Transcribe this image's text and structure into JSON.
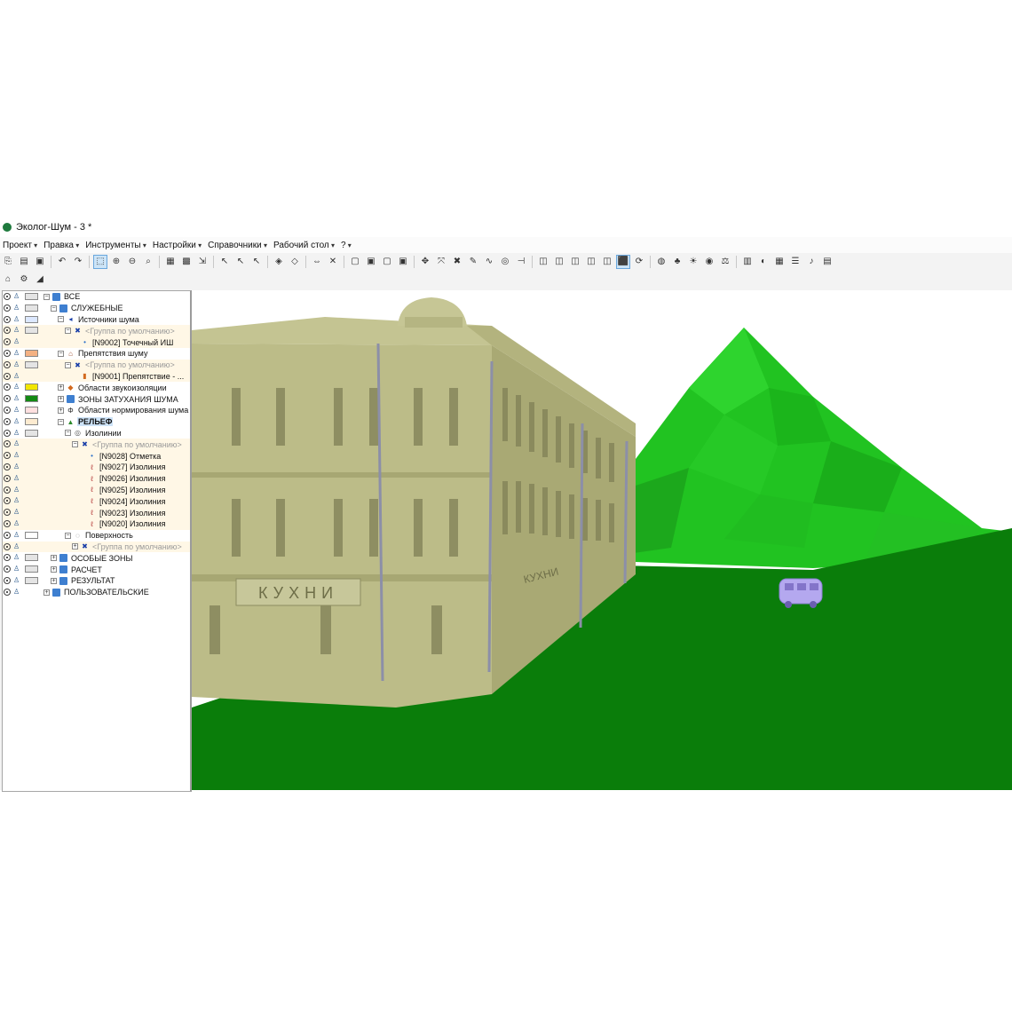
{
  "window": {
    "title": "Эколог-Шум - 3 *"
  },
  "menu": [
    "Проект",
    "Правка",
    "Инструменты",
    "Настройки",
    "Справочники",
    "Рабочий стол",
    "?"
  ],
  "tree": {
    "rows": [
      {
        "label": "ВСЕ",
        "indent": 0,
        "expander": "−",
        "icon": "folder",
        "swatch": "#e4e4e4",
        "tinted": false
      },
      {
        "label": "СЛУЖЕБНЫЕ",
        "indent": 1,
        "expander": "−",
        "icon": "folder",
        "swatch": "#e4e4e4",
        "tinted": false
      },
      {
        "label": "Источники шума",
        "indent": 2,
        "expander": "−",
        "icon": "noise-source",
        "swatch": "#dce8ff",
        "tinted": false
      },
      {
        "label": "<Группа по умолчанию>",
        "indent": 3,
        "expander": "−",
        "icon": "group",
        "swatch": "#e4e4e4",
        "tinted": true,
        "grey": true
      },
      {
        "label": "[N9002] Точечный ИШ",
        "indent": 4,
        "expander": "",
        "icon": "dot",
        "swatch": "",
        "tinted": true
      },
      {
        "label": "Препятствия шуму",
        "indent": 2,
        "expander": "−",
        "icon": "obstacle",
        "swatch": "#f4b183",
        "tinted": false
      },
      {
        "label": "<Группа по умолчанию>",
        "indent": 3,
        "expander": "−",
        "icon": "group",
        "swatch": "#e4e4e4",
        "tinted": true,
        "grey": true
      },
      {
        "label": "[N9001] Препятствие - ...",
        "indent": 4,
        "expander": "",
        "icon": "obstacle-item",
        "swatch": "",
        "tinted": true
      },
      {
        "label": "Области звукоизоляции",
        "indent": 2,
        "expander": "+",
        "icon": "insulation",
        "swatch": "#f2e600",
        "tinted": false
      },
      {
        "label": "ЗОНЫ ЗАТУХАНИЯ ШУМА",
        "indent": 2,
        "expander": "+",
        "icon": "folder",
        "swatch": "#138a13",
        "tinted": false
      },
      {
        "label": "Области нормирования шума",
        "indent": 2,
        "expander": "+",
        "icon": "norm",
        "swatch": "#ffe0e0",
        "tinted": false
      },
      {
        "label": "РЕЛЬЕФ",
        "indent": 2,
        "expander": "−",
        "icon": "relief",
        "swatch": "#fdebd0",
        "tinted": false,
        "selected": true
      },
      {
        "label": "Изолинии",
        "indent": 3,
        "expander": "−",
        "icon": "isoline-group",
        "swatch": "#e4e4e4",
        "tinted": false
      },
      {
        "label": "<Группа по умолчанию>",
        "indent": 4,
        "expander": "−",
        "icon": "group",
        "swatch": "",
        "tinted": true,
        "grey": true
      },
      {
        "label": "[N9028] Отметка",
        "indent": 5,
        "expander": "",
        "icon": "dot",
        "swatch": "",
        "tinted": true
      },
      {
        "label": "[N9027] Изолиния",
        "indent": 5,
        "expander": "",
        "icon": "isoline",
        "swatch": "",
        "tinted": true
      },
      {
        "label": "[N9026] Изолиния",
        "indent": 5,
        "expander": "",
        "icon": "isoline",
        "swatch": "",
        "tinted": true
      },
      {
        "label": "[N9025] Изолиния",
        "indent": 5,
        "expander": "",
        "icon": "isoline",
        "swatch": "",
        "tinted": true
      },
      {
        "label": "[N9024] Изолиния",
        "indent": 5,
        "expander": "",
        "icon": "isoline",
        "swatch": "",
        "tinted": true
      },
      {
        "label": "[N9023] Изолиния",
        "indent": 5,
        "expander": "",
        "icon": "isoline",
        "swatch": "",
        "tinted": true
      },
      {
        "label": "[N9020] Изолиния",
        "indent": 5,
        "expander": "",
        "icon": "isoline",
        "swatch": "",
        "tinted": true
      },
      {
        "label": "Поверхность",
        "indent": 3,
        "expander": "−",
        "icon": "surface",
        "swatch": "#ffffff",
        "tinted": false
      },
      {
        "label": "<Группа по умолчанию>",
        "indent": 4,
        "expander": "+",
        "icon": "group",
        "swatch": "",
        "tinted": true,
        "grey": true
      },
      {
        "label": "ОСОБЫЕ ЗОНЫ",
        "indent": 1,
        "expander": "+",
        "icon": "folder",
        "swatch": "#e4e4e4",
        "tinted": false
      },
      {
        "label": "РАСЧЕТ",
        "indent": 1,
        "expander": "+",
        "icon": "folder",
        "swatch": "#e4e4e4",
        "tinted": false
      },
      {
        "label": "РЕЗУЛЬТАТ",
        "indent": 1,
        "expander": "+",
        "icon": "folder",
        "swatch": "#e4e4e4",
        "tinted": false
      },
      {
        "label": "ПОЛЬЗОВАТЕЛЬСКИЕ",
        "indent": 0,
        "expander": "+",
        "icon": "folder",
        "swatch": "",
        "tinted": false
      }
    ]
  },
  "viewport": {
    "sign_text": "КУХНИ",
    "sign_text_side": "КУХНИ",
    "colors": {
      "ground": "#0a7d0a",
      "hill": "#22c422",
      "building": "#b9b984",
      "vehicle": "#b4a8ef"
    }
  },
  "toolbar1": [
    "open-icon",
    "folder-open-icon",
    "save-icon",
    "sep",
    "undo-icon",
    "redo-icon",
    "sep",
    "select-icon",
    "zoom-in-icon",
    "zoom-out-icon",
    "zoom-window-icon",
    "sep",
    "map-icon",
    "grid-icon",
    "export-icon",
    "sep",
    "pointer-icon",
    "pointer-add-icon",
    "pointer-remove-icon",
    "sep",
    "node-icon",
    "node-move-icon",
    "sep",
    "measure-icon",
    "clear-icon",
    "sep",
    "layer1-icon",
    "layer2-icon",
    "layer3-icon",
    "layer4-icon",
    "sep",
    "move-icon",
    "scale-icon",
    "delete-icon",
    "edit-icon",
    "curve-icon",
    "circle-icon",
    "ruler-icon",
    "sep",
    "attr1-icon",
    "attr2-icon",
    "attr3-icon",
    "attr4-icon",
    "attr5-icon",
    "view-3d-icon",
    "view-3d-rotate-icon",
    "sep",
    "fill-icon",
    "tree-icon",
    "light-icon",
    "camera-icon",
    "balance-icon",
    "sep",
    "box-icon",
    "globe-icon",
    "grid-3d-icon",
    "layers-icon",
    "sound-icon",
    "report-icon"
  ],
  "toolbar2": [
    "home-icon",
    "settings-icon",
    "eraser-icon"
  ]
}
